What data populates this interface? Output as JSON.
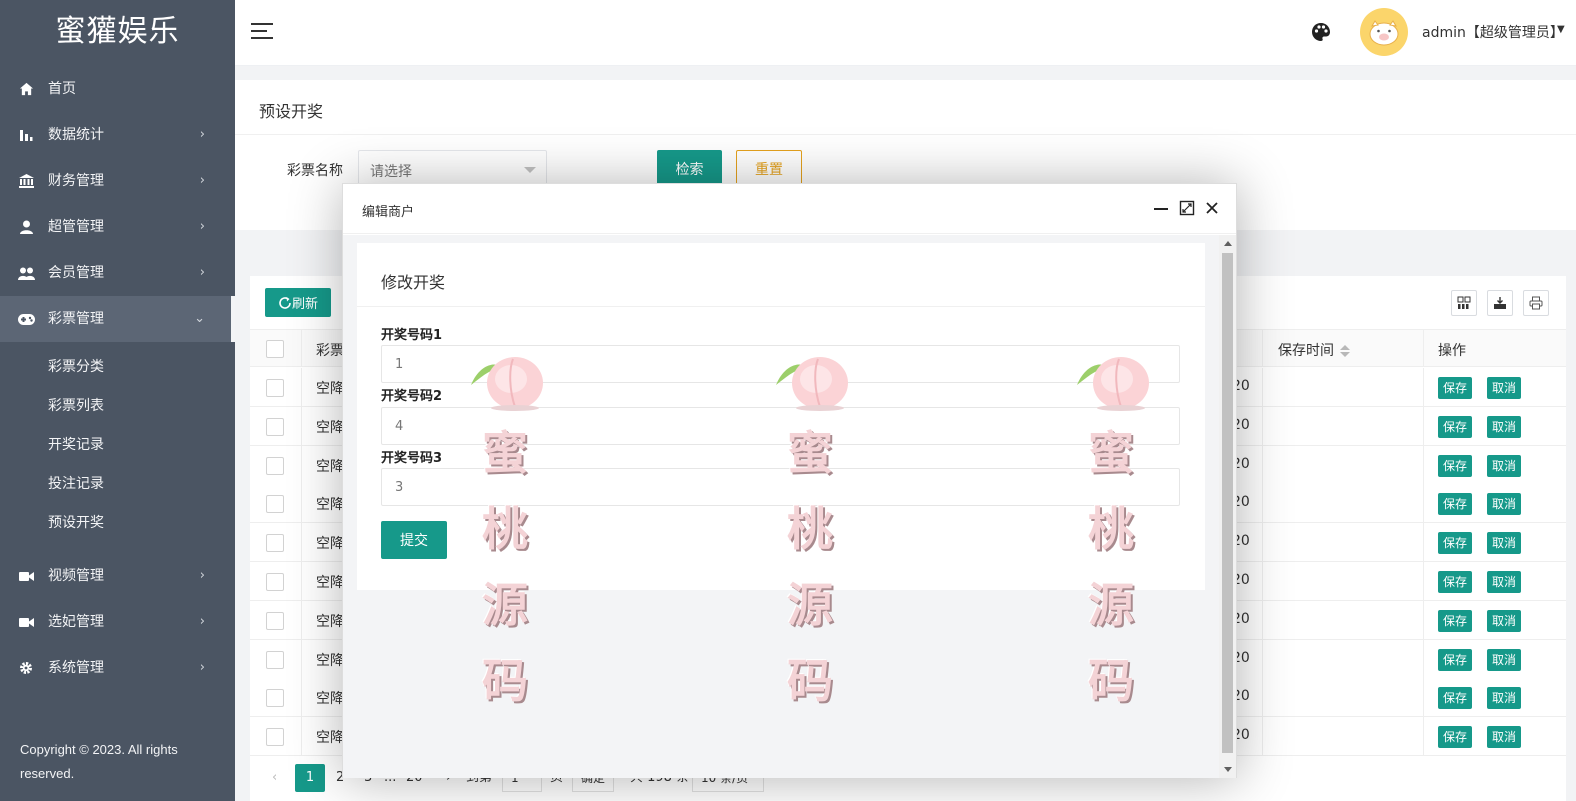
{
  "brand": "蜜獾娱乐",
  "sidebar": {
    "items": [
      {
        "label": "首页",
        "icon": "home-icon"
      },
      {
        "label": "数据统计",
        "icon": "bar-chart-icon"
      },
      {
        "label": "财务管理",
        "icon": "bank-icon"
      },
      {
        "label": "超管管理",
        "icon": "user-icon"
      },
      {
        "label": "会员管理",
        "icon": "users-icon"
      },
      {
        "label": "彩票管理",
        "icon": "gamepad-icon"
      },
      {
        "label": "视频管理",
        "icon": "video-icon"
      },
      {
        "label": "选妃管理",
        "icon": "video-icon"
      },
      {
        "label": "系统管理",
        "icon": "gear-icon"
      }
    ],
    "submenu": [
      "彩票分类",
      "彩票列表",
      "开奖记录",
      "投注记录",
      "预设开奖"
    ],
    "copyright": "Copyright © 2023. All rights reserved."
  },
  "header": {
    "user": "admin【超级管理员】"
  },
  "page": {
    "title": "预设开奖",
    "filter_label": "彩票名称",
    "select_placeholder": "请选择",
    "search_label": "检索",
    "reset_label": "重置"
  },
  "table": {
    "refresh_label": "刷新",
    "col_name": "彩票",
    "col_save_time": "保存时间",
    "col_actions": "操作",
    "row_name": "空降",
    "row_tail": "20",
    "save_label": "保存",
    "cancel_label": "取消",
    "rows": 10
  },
  "pager": {
    "current": "1",
    "p2": "2",
    "p3": "3",
    "ellipsis": "...",
    "last": "20",
    "goto": "到第",
    "page_input": "1",
    "page_unit": "页",
    "confirm": "确定",
    "total": "共 198 条",
    "per_page": "10 条/页"
  },
  "modal": {
    "title": "编辑商户",
    "card_title": "修改开奖",
    "fields": [
      {
        "label": "开奖号码1",
        "value": "1"
      },
      {
        "label": "开奖号码2",
        "value": "4"
      },
      {
        "label": "开奖号码3",
        "value": "3"
      }
    ],
    "submit_label": "提交"
  },
  "watermark": [
    "蜜",
    "桃",
    "源",
    "码"
  ],
  "colors": {
    "primary": "#16998a",
    "sidebar": "#4b5563",
    "warning": "#e5a21e"
  }
}
